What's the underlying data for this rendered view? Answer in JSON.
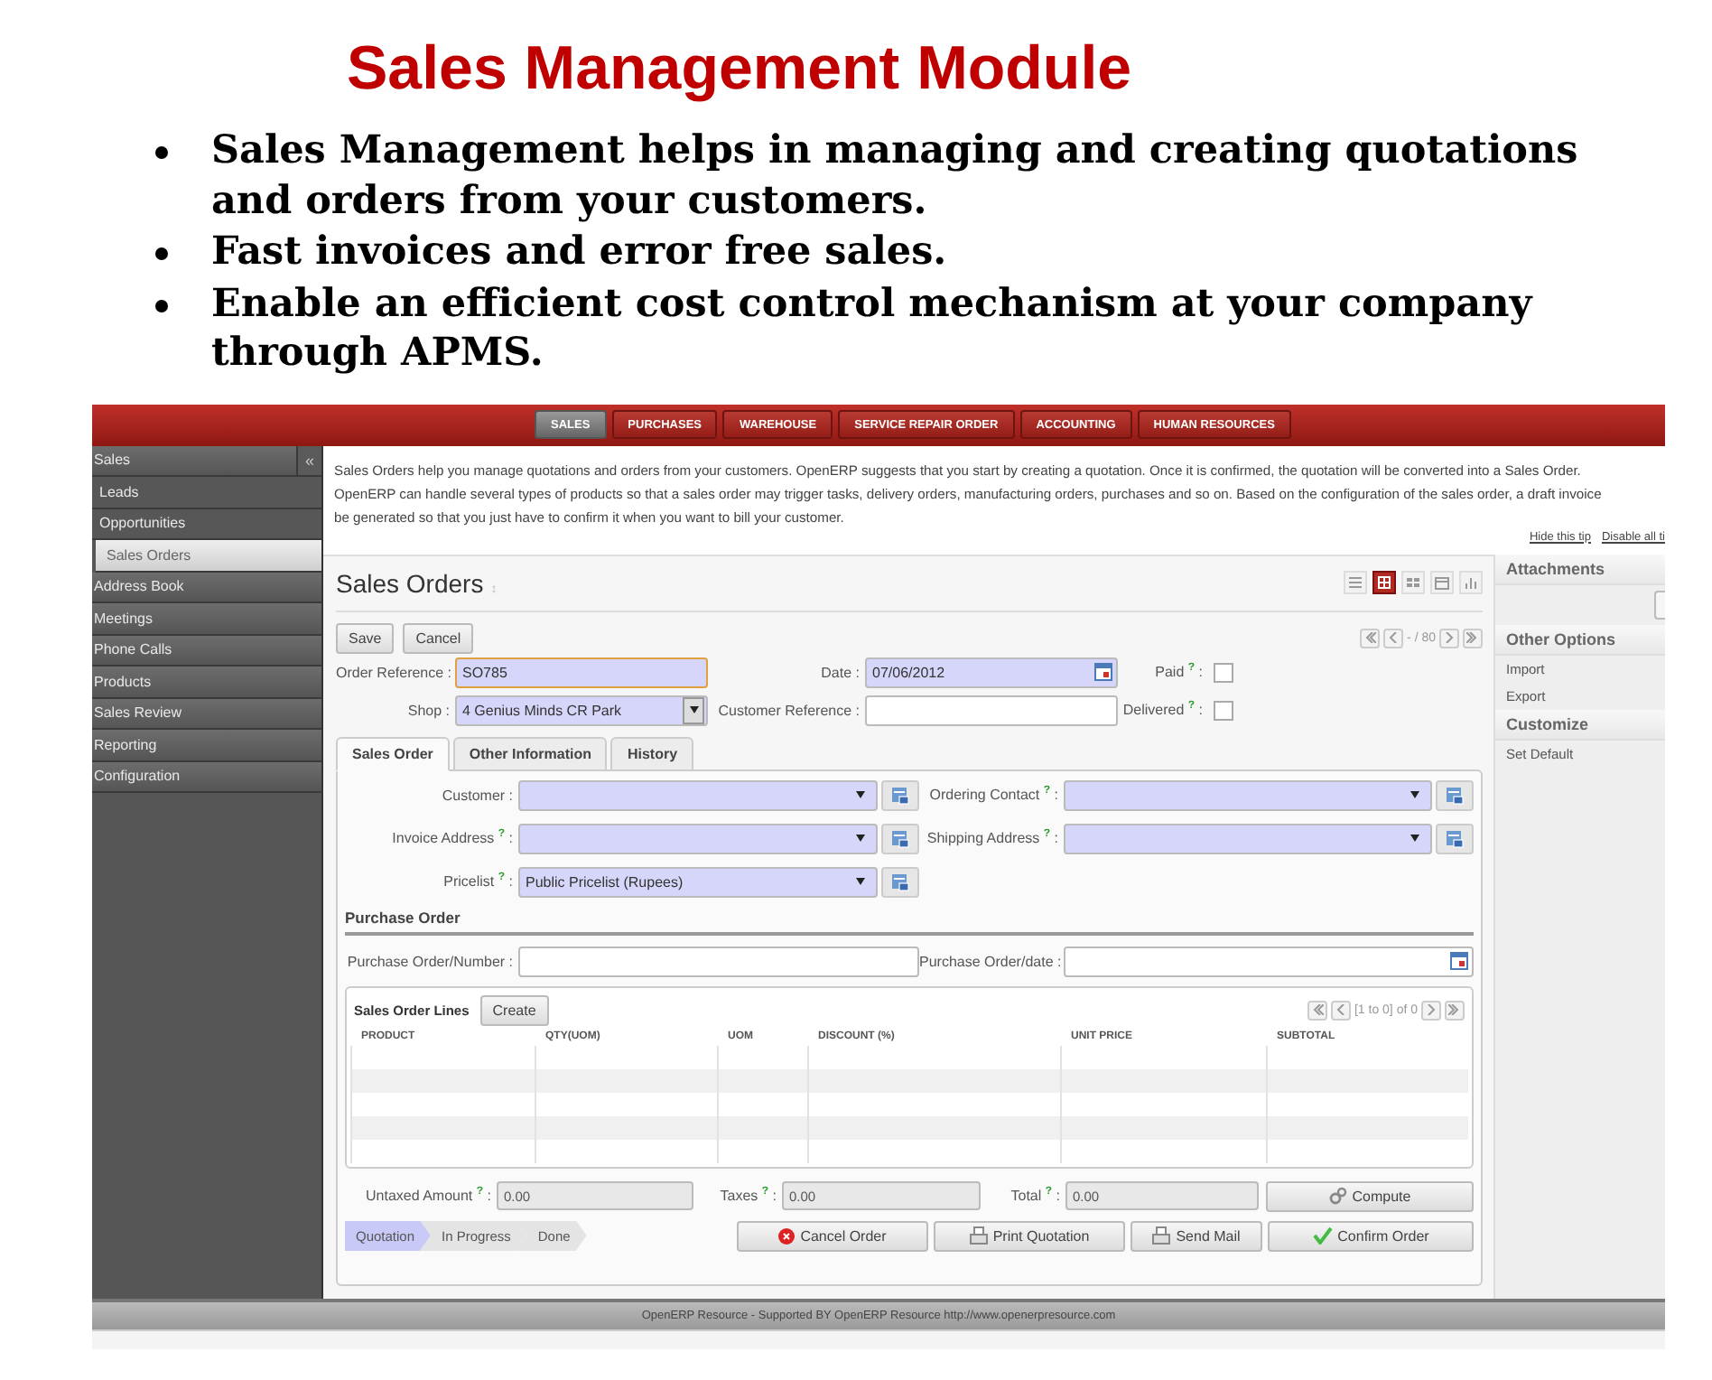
{
  "title": "Sales Management Module",
  "bullets": [
    "Sales Management helps in managing and creating quotations and orders from your customers.",
    "Fast invoices and error free sales.",
    "Enable an efficient cost control mechanism at your company through APMS."
  ],
  "app": {
    "top_menu": [
      {
        "label": "SALES",
        "selected": true
      },
      {
        "label": "PURCHASES",
        "selected": false
      },
      {
        "label": "WAREHOUSE",
        "selected": false
      },
      {
        "label": "SERVICE REPAIR ORDER",
        "selected": false
      },
      {
        "label": "ACCOUNTING",
        "selected": false
      },
      {
        "label": "HUMAN RESOURCES",
        "selected": false
      }
    ],
    "sidebar": {
      "collapse": "«",
      "items": [
        {
          "label": "Sales",
          "selected": false,
          "children": [
            {
              "label": "Leads",
              "selected": false
            },
            {
              "label": "Opportunities",
              "selected": false
            },
            {
              "label": "Sales Orders",
              "selected": true
            }
          ]
        },
        {
          "label": "Address Book",
          "selected": false
        },
        {
          "label": "Meetings",
          "selected": false
        },
        {
          "label": "Phone Calls",
          "selected": false
        },
        {
          "label": "Products",
          "selected": false
        },
        {
          "label": "Sales Review",
          "selected": false
        },
        {
          "label": "Reporting",
          "selected": false
        },
        {
          "label": "Configuration",
          "selected": false
        }
      ]
    },
    "tip": {
      "lines": [
        "Sales Orders help you manage quotations and orders from your customers. OpenERP suggests that you start by creating a quotation. Once it is confirmed, the quotation will be converted into a Sales Order.",
        "OpenERP can handle several types of products so that a sales order may trigger tasks, delivery orders, manufacturing orders, purchases and so on. Based on the configuration of the sales order, a draft invoice",
        "be generated so that you just have to confirm it when you want to bill your customer."
      ],
      "links": [
        "Hide this tip",
        "Disable all ti"
      ]
    },
    "form": {
      "title": "Sales Orders",
      "title_mark": "↕",
      "view_modes": [
        {
          "kind": "list",
          "selected": false
        },
        {
          "kind": "form",
          "selected": true
        },
        {
          "kind": "kanban",
          "selected": false
        },
        {
          "kind": "calendar",
          "selected": false
        },
        {
          "kind": "graph",
          "selected": false
        }
      ],
      "pager": "- / 80",
      "buttons": [
        "Save",
        "Cancel"
      ],
      "header_rows": [
        [
          {
            "kind": "text",
            "label": "Order Reference :",
            "value": "SO785",
            "required": true,
            "focused": true
          },
          {
            "kind": "date",
            "label": "Date :",
            "value": "07/06/2012",
            "required": true
          },
          {
            "kind": "checkbox",
            "label": "Paid $^{?}$ :",
            "checked": false
          }
        ],
        [
          {
            "kind": "select",
            "label": "Shop :",
            "value": "4 Genius Minds CR Park",
            "required": true
          },
          {
            "kind": "text",
            "label": "Customer Reference :",
            "required": false,
            "focused": false
          },
          {
            "kind": "checkbox",
            "label": "Delivered $^{?}$ :",
            "checked": false
          }
        ]
      ],
      "tabs": [
        {
          "label": "Sales Order",
          "selected": true
        },
        {
          "label": "Other Information",
          "selected": false
        },
        {
          "label": "History",
          "selected": false
        }
      ],
      "tab_rows": [
        [
          {
            "kind": "many2one",
            "label": "Customer :",
            "required": true
          },
          {
            "kind": "many2one",
            "label": "Ordering Contact $^{?}$ :",
            "required": true
          }
        ],
        [
          {
            "kind": "many2one",
            "label": "Invoice Address $^{?}$ :",
            "required": true
          },
          {
            "kind": "many2one",
            "label": "Shipping Address $^{?}$ :",
            "required": true
          }
        ],
        [
          {
            "kind": "many2one",
            "label": "Pricelist $^{?}$ :",
            "value": "Public Pricelist (Rupees)",
            "required": true
          }
        ]
      ],
      "purchase_order": {
        "title": "Purchase Order",
        "fields": [
          {
            "kind": "text",
            "label": "Purchase Order/Number :",
            "required": false,
            "focused": false
          },
          {
            "kind": "date",
            "label": "Purchase Order/date :",
            "required": false
          }
        ]
      },
      "lines": {
        "title": "Sales Order Lines",
        "create": "Create",
        "pager": "[1 to 0] of 0",
        "columns": [
          "PRODUCT",
          "QTY(UOM)",
          "UOM",
          "DISCOUNT (%)",
          "UNIT PRICE",
          "SUBTOTAL"
        ]
      },
      "totals": [
        {
          "label": "Untaxed Amount $^{?}$ :",
          "value": "0.00"
        },
        {
          "label": "Taxes $^{?}$ :",
          "value": "0.00"
        },
        {
          "label": "Total $^{?}$ :",
          "value": "0.00"
        }
      ],
      "compute": "Compute",
      "steps": [
        {
          "label": "Quotation",
          "selected": true
        },
        {
          "label": "In Progress",
          "selected": false
        },
        {
          "label": "Done",
          "selected": false
        }
      ],
      "actions": [
        {
          "kind": "cancel",
          "label": "Cancel Order"
        },
        {
          "kind": "print",
          "label": "Print Quotation"
        },
        {
          "kind": "mail",
          "label": "Send Mail"
        },
        {
          "kind": "confirm",
          "label": "Confirm Order"
        }
      ]
    },
    "side_panel": [
      {
        "kind": "attachments",
        "title": "Attachments"
      },
      {
        "kind": "options",
        "title": "Other Options",
        "items": [
          "Import",
          "Export"
        ]
      },
      {
        "kind": "options",
        "title": "Customize",
        "items": [
          "Set Default"
        ]
      }
    ],
    "footer": "OpenERP Resource - Supported BY OpenERP Resource http://www.openerpresource.com"
  }
}
